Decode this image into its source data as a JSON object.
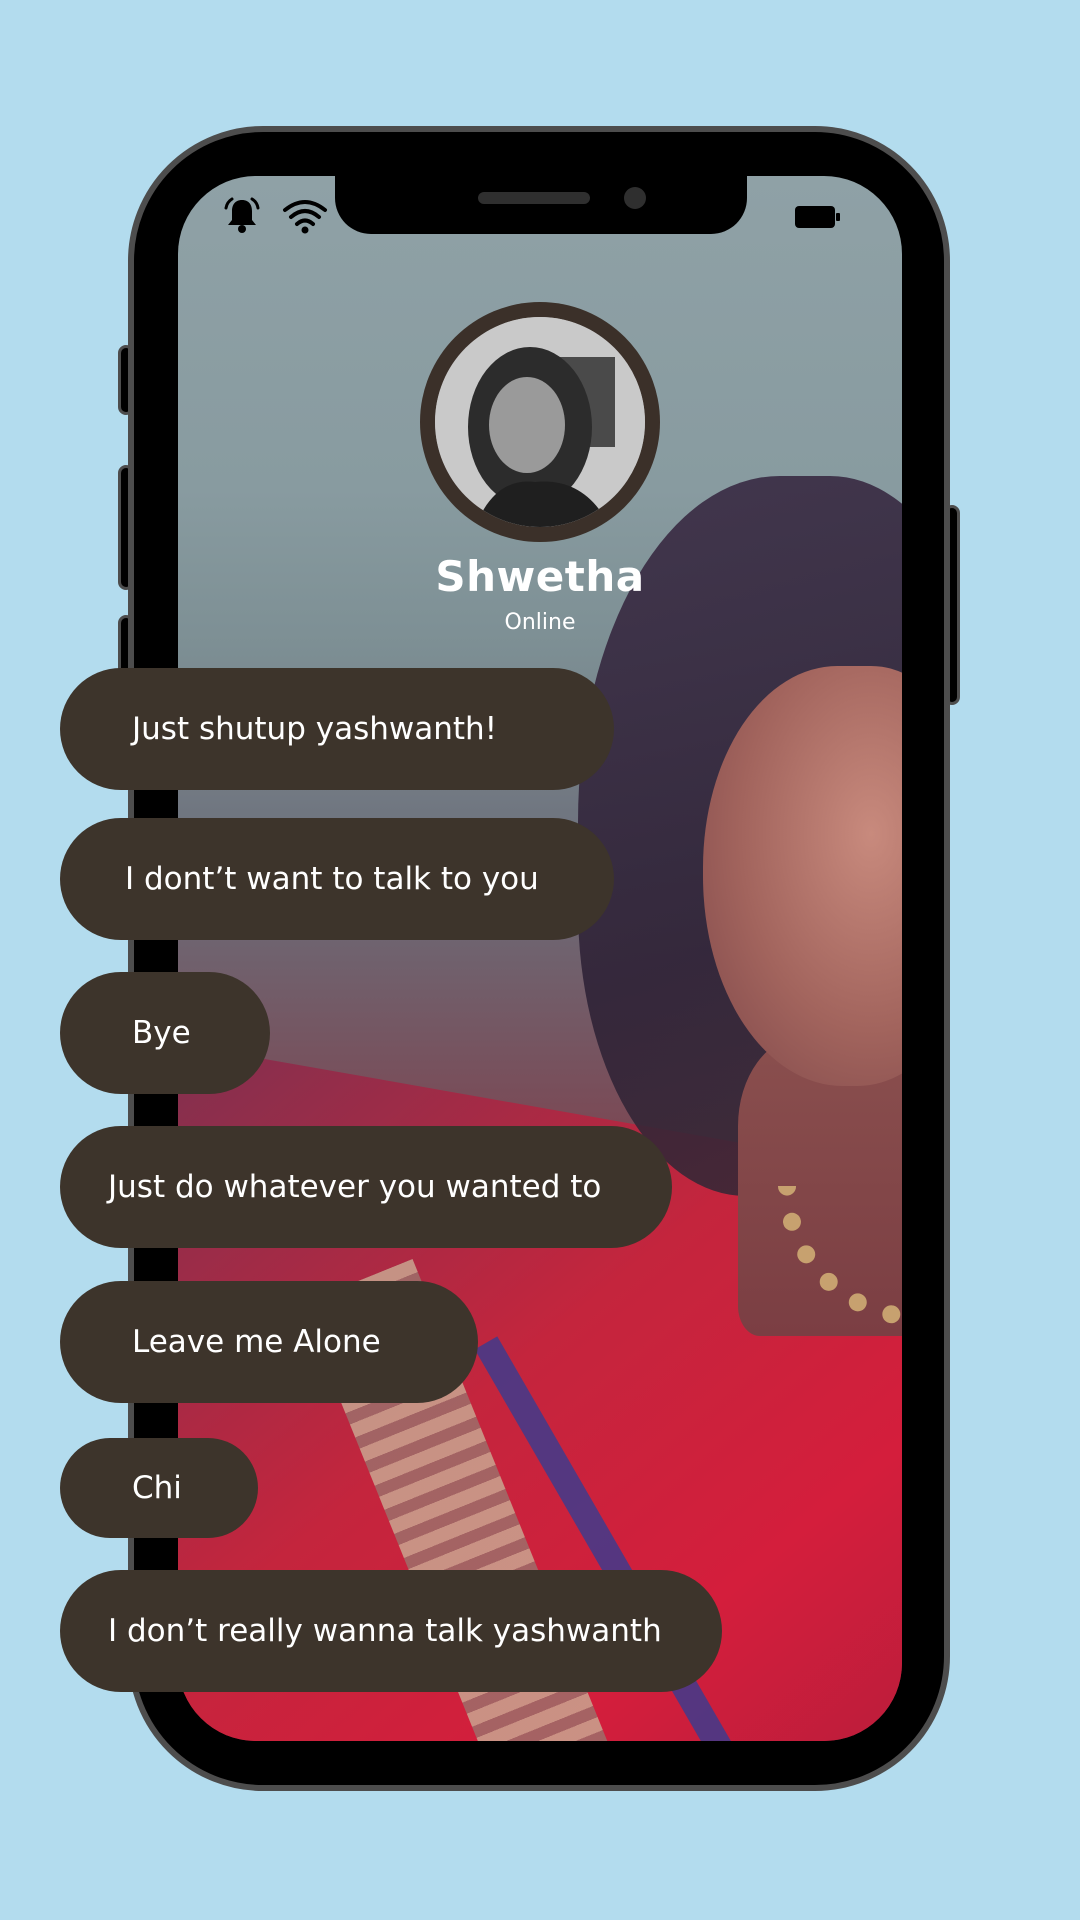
{
  "status_bar": {
    "icons": [
      "bell-icon",
      "wifi-icon",
      "battery-icon"
    ]
  },
  "contact": {
    "name": "Shwetha",
    "status": "Online"
  },
  "messages": [
    {
      "text": "Just shutup yashwanth!"
    },
    {
      "text": "I dont’t want to talk to you"
    },
    {
      "text": "Bye"
    },
    {
      "text": "Just do whatever you wanted to"
    },
    {
      "text": "Leave me Alone"
    },
    {
      "text": "Chi"
    },
    {
      "text": "I don’t really wanna talk yashwanth"
    }
  ],
  "colors": {
    "page_background": "#b3dcee",
    "phone_frame": "#000000",
    "phone_border": "#4d4d4d",
    "bubble": "#3d342b",
    "bubble_text": "#ffffff",
    "avatar_ring": "#3b3029"
  }
}
